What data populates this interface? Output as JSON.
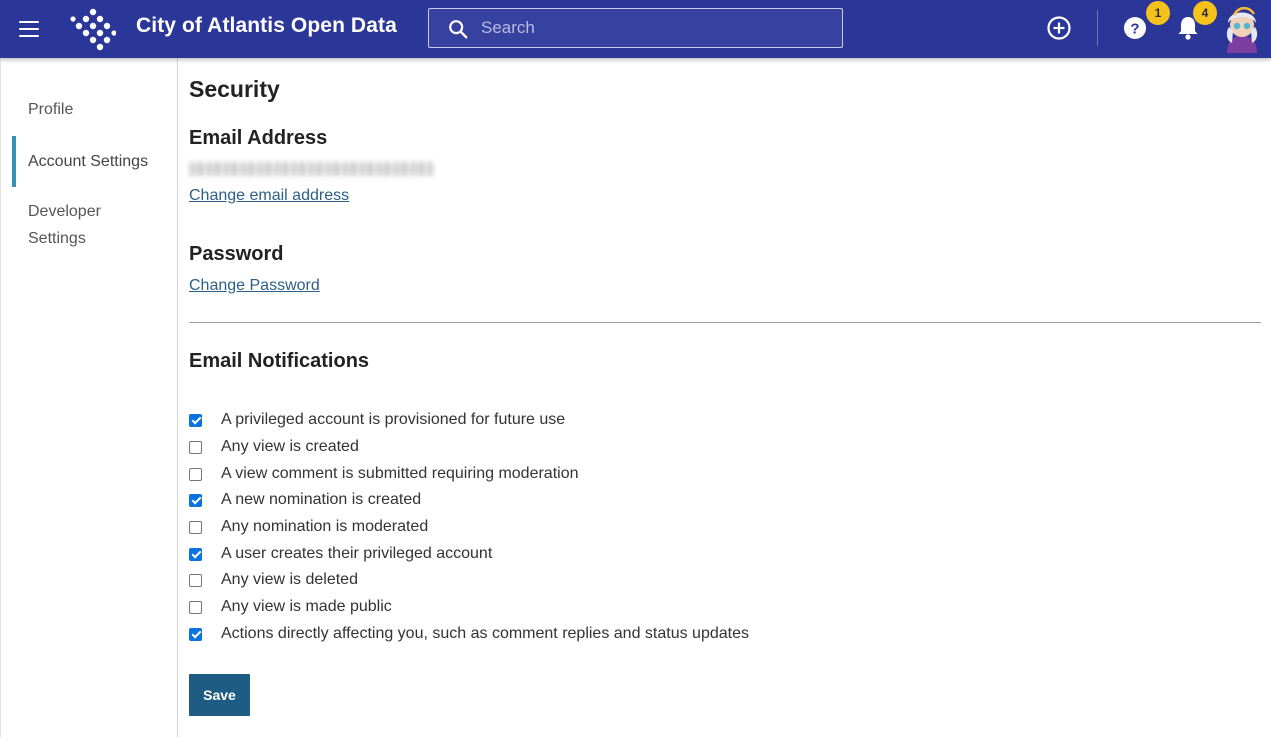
{
  "header": {
    "title": "City of Atlantis Open Data",
    "search_placeholder": "Search",
    "help_badge": "1",
    "notifications_badge": "4",
    "brand_color": "#2b3699",
    "icons": [
      "menu-icon",
      "logo-icon",
      "search-icon",
      "add-circle-icon",
      "help-icon",
      "bell-icon",
      "avatar"
    ]
  },
  "sidebar": {
    "items": [
      {
        "label": "Profile"
      },
      {
        "label": "Account Settings",
        "active": true
      },
      {
        "label": "Developer Settings"
      }
    ]
  },
  "main": {
    "page_title": "Security",
    "email_heading": "Email Address",
    "change_email_link": "Change email address",
    "password_heading": "Password",
    "change_password_link": "Change Password",
    "notifications_heading": "Email Notifications",
    "notifications": [
      {
        "label": "A privileged account is provisioned for future use",
        "checked": true
      },
      {
        "label": "Any view is created",
        "checked": false
      },
      {
        "label": "A view comment is submitted requiring moderation",
        "checked": false
      },
      {
        "label": "A new nomination is created",
        "checked": true
      },
      {
        "label": "Any nomination is moderated",
        "checked": false
      },
      {
        "label": "A user creates their privileged account",
        "checked": true
      },
      {
        "label": "Any view is deleted",
        "checked": false
      },
      {
        "label": "Any view is made public",
        "checked": false
      },
      {
        "label": "Actions directly affecting you, such as comment replies and status updates",
        "checked": true
      }
    ],
    "save_label": "Save"
  }
}
